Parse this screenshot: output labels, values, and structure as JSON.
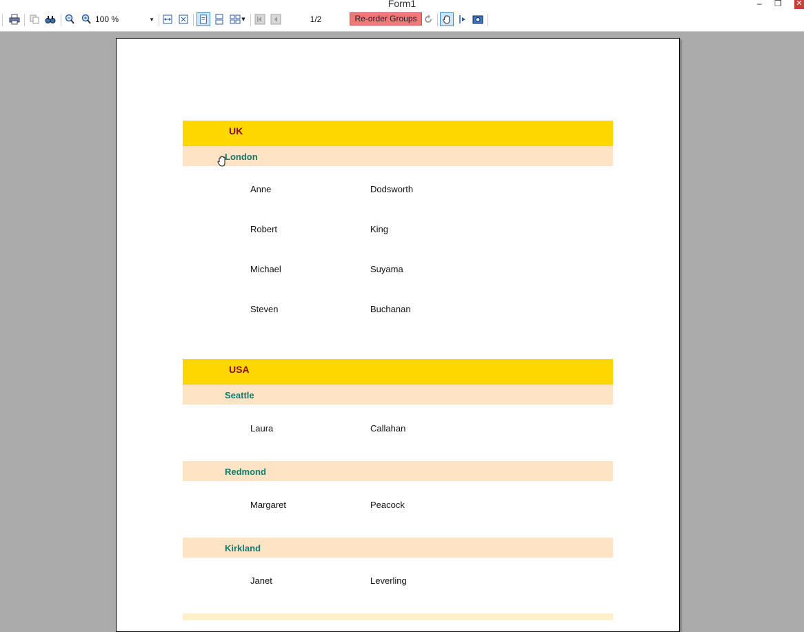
{
  "window": {
    "title": "Form1",
    "minimize_glyph": "–",
    "restore_glyph": "❐",
    "close_glyph": "✕"
  },
  "toolbar": {
    "zoom_value": "100 %",
    "page_indicator": "1/2",
    "reorder_label": "Re-order Groups",
    "icons": [
      "print-icon",
      "copy-icon",
      "find-icon",
      "zoom-out-icon",
      "zoom-in-icon",
      "page-width-icon",
      "whole-page-icon",
      "single-page-icon",
      "continuous-icon",
      "multi-page-icon",
      "first-page-icon",
      "previous-page-icon",
      "refresh-icon",
      "hand-tool-icon",
      "text-select-icon",
      "snapshot-icon"
    ]
  },
  "report": {
    "groups": [
      {
        "country": "UK",
        "cities": [
          {
            "name": "London",
            "employees": [
              {
                "first": "Anne",
                "last": "Dodsworth"
              },
              {
                "first": "Robert",
                "last": "King"
              },
              {
                "first": "Michael",
                "last": "Suyama"
              },
              {
                "first": "Steven",
                "last": "Buchanan"
              }
            ]
          }
        ]
      },
      {
        "country": "USA",
        "cities": [
          {
            "name": "Seattle",
            "employees": [
              {
                "first": "Laura",
                "last": "Callahan"
              }
            ]
          },
          {
            "name": "Redmond",
            "employees": [
              {
                "first": "Margaret",
                "last": "Peacock"
              }
            ]
          },
          {
            "name": "Kirkland",
            "employees": [
              {
                "first": "Janet",
                "last": "Leverling"
              }
            ]
          }
        ]
      }
    ]
  },
  "colors": {
    "country_band": "#ffd700",
    "country_text": "#8b0a0a",
    "city_band": "#fee4c4",
    "city_text": "#0f7b6e",
    "reorder_button": "#f07878",
    "viewer_background": "#ababab"
  }
}
